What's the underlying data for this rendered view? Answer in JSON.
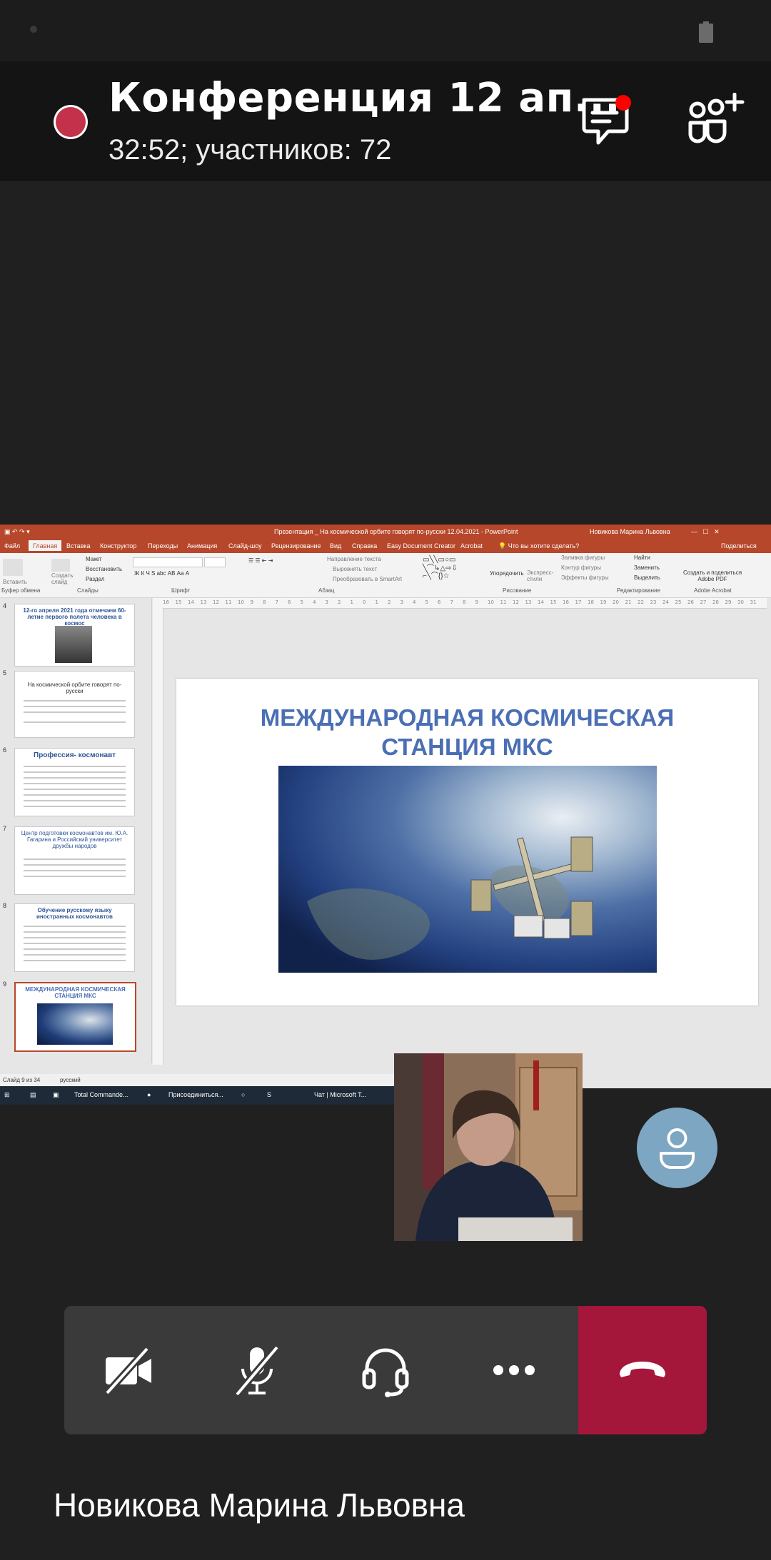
{
  "status_bar": {
    "battery_icon": "battery-icon"
  },
  "header": {
    "title": "Конференция 12 ап...",
    "subtitle": "32:52; участников: 72",
    "recording_color": "#c4314b",
    "chat_icon": "chat-icon",
    "people_icon": "add-people-icon",
    "notification_color": "#ff0000"
  },
  "powerpoint": {
    "window_title": "Презентация _ На космической орбите говорят по-русски 12.04.2021 - PowerPoint",
    "user_name": "Новикова Марина Львовна",
    "menu": [
      "Файл",
      "Главная",
      "Вставка",
      "Конструктор",
      "Переходы",
      "Анимация",
      "Слайд-шоу",
      "Рецензирование",
      "Вид",
      "Справка",
      "Easy Document Creator",
      "Acrobat"
    ],
    "tell_me": "Что вы хотите сделать?",
    "share": "Поделиться",
    "ribbon_groups": [
      "Буфер обмена",
      "Слайды",
      "Шрифт",
      "Абзац",
      "Рисование",
      "Редактирование",
      "Adobe Acrobat"
    ],
    "ribbon_items": {
      "paste": "Вставить",
      "create_slide": "Создать слайд",
      "layout": "Макет",
      "reset": "Восстановить",
      "section": "Раздел",
      "text_direction": "Направление текста",
      "align_text": "Выровнять текст",
      "smartart": "Преобразовать в SmartArt",
      "arrange": "Упорядочить",
      "quick_styles": "Экспресс-стили",
      "shape_fill": "Заливка фигуры",
      "shape_outline": "Контур фигуры",
      "shape_effects": "Эффекты фигуры",
      "find": "Найти",
      "replace": "Заменить",
      "select": "Выделить",
      "adobe_pdf": "Создать и поделиться Adobe PDF"
    },
    "thumbnails": [
      {
        "num": "4",
        "title": "12-го апреля 2021 года отмечаем 60-летие первого полета человека в космос"
      },
      {
        "num": "5",
        "title": "На космической орбите говорят по-русски"
      },
      {
        "num": "6",
        "title": "Профессия- космонавт"
      },
      {
        "num": "7",
        "title": "Центр подготовки космонавтов им. Ю.А. Гагарина и Российский университет дружбы народов"
      },
      {
        "num": "8",
        "title": "Обучение русскому языку иностранных космонавтов"
      },
      {
        "num": "9",
        "title": "МЕЖДУНАРОДНАЯ КОСМИЧЕСКАЯ СТАНЦИЯ МКС"
      }
    ],
    "slide_title_line1": "МЕЖДУНАРОДНАЯ КОСМИЧЕСКАЯ",
    "slide_title_line2": "СТАНЦИЯ МКС",
    "status_slide": "Слайд 9 из 34",
    "status_lang": "русский"
  },
  "taskbar": {
    "items": [
      "Total Commande...",
      "Присоединиться...",
      "Чат | Microsoft T..."
    ]
  },
  "controls": {
    "camera": "camera-off-icon",
    "mic": "mic-off-icon",
    "audio": "headset-icon",
    "more": "more-icon",
    "end": "hang-up-icon",
    "end_color": "#a4163a"
  },
  "participant": {
    "name": "Новикова Марина Львовна"
  }
}
